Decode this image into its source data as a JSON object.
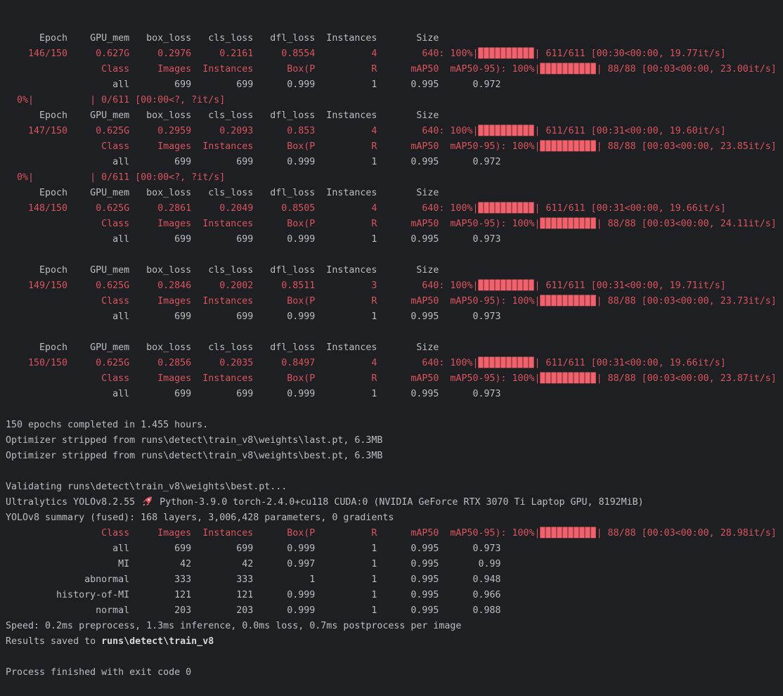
{
  "terminal": {
    "colors": {
      "background": "#1e1f22",
      "text_gray": "#bcbec4",
      "text_red": "#d9545e",
      "progress_bar_fill": "#f2606b",
      "bold_text": "#d6d9de"
    },
    "icons": {
      "rocket": "rocket-icon"
    },
    "lines": [
      {
        "name": "epoch-table-header",
        "segments": [
          {
            "style": "gray",
            "text": "      Epoch    GPU_mem   box_loss   cls_loss   dfl_loss  Instances       Size"
          }
        ]
      },
      {
        "name": "epoch-progress-row",
        "segments": [
          {
            "style": "red",
            "text": "    146/150     0.627G     0.2976     0.2161     0.8554          4        640: 100%|"
          },
          {
            "style": "bar",
            "text": "▉▉▉▉▉▉▉▉▉▉"
          },
          {
            "style": "red",
            "text": "| 611/611 [00:30<00:00, 19.77it/s]"
          }
        ]
      },
      {
        "name": "val-metrics-header",
        "segments": [
          {
            "style": "red",
            "text": "                 Class     Images  Instances      Box(P          R      mAP50  mAP50-95): 100%|"
          },
          {
            "style": "bar",
            "text": "▉▉▉▉▉▉▉▉▉▉"
          },
          {
            "style": "red",
            "text": "| 88/88 [00:03<00:00, 23.00it/s]"
          }
        ]
      },
      {
        "name": "val-all-row",
        "segments": [
          {
            "style": "gray",
            "text": "                   all        699        699      0.999          1      0.995      0.972"
          }
        ]
      },
      {
        "name": "dataloader-progress-row",
        "segments": [
          {
            "style": "red",
            "text": "  0%|          | 0/611 [00:00<?, ?it/s]"
          }
        ]
      },
      {
        "name": "epoch-table-header",
        "segments": [
          {
            "style": "gray",
            "text": "      Epoch    GPU_mem   box_loss   cls_loss   dfl_loss  Instances       Size"
          }
        ]
      },
      {
        "name": "epoch-progress-row",
        "segments": [
          {
            "style": "red",
            "text": "    147/150     0.625G     0.2959     0.2093      0.853          4        640: 100%|"
          },
          {
            "style": "bar",
            "text": "▉▉▉▉▉▉▉▉▉▉"
          },
          {
            "style": "red",
            "text": "| 611/611 [00:31<00:00, 19.60it/s]"
          }
        ]
      },
      {
        "name": "val-metrics-header",
        "segments": [
          {
            "style": "red",
            "text": "                 Class     Images  Instances      Box(P          R      mAP50  mAP50-95): 100%|"
          },
          {
            "style": "bar",
            "text": "▉▉▉▉▉▉▉▉▉▉"
          },
          {
            "style": "red",
            "text": "| 88/88 [00:03<00:00, 23.85it/s]"
          }
        ]
      },
      {
        "name": "val-all-row",
        "segments": [
          {
            "style": "gray",
            "text": "                   all        699        699      0.999          1      0.995      0.972"
          }
        ]
      },
      {
        "name": "dataloader-progress-row",
        "segments": [
          {
            "style": "red",
            "text": "  0%|          | 0/611 [00:00<?, ?it/s]"
          }
        ]
      },
      {
        "name": "epoch-table-header",
        "segments": [
          {
            "style": "gray",
            "text": "      Epoch    GPU_mem   box_loss   cls_loss   dfl_loss  Instances       Size"
          }
        ]
      },
      {
        "name": "epoch-progress-row",
        "segments": [
          {
            "style": "red",
            "text": "    148/150     0.625G     0.2861     0.2049     0.8505          4        640: 100%|"
          },
          {
            "style": "bar",
            "text": "▉▉▉▉▉▉▉▉▉▉"
          },
          {
            "style": "red",
            "text": "| 611/611 [00:31<00:00, 19.66it/s]"
          }
        ]
      },
      {
        "name": "val-metrics-header",
        "segments": [
          {
            "style": "red",
            "text": "                 Class     Images  Instances      Box(P          R      mAP50  mAP50-95): 100%|"
          },
          {
            "style": "bar",
            "text": "▉▉▉▉▉▉▉▉▉▉"
          },
          {
            "style": "red",
            "text": "| 88/88 [00:03<00:00, 24.11it/s]"
          }
        ]
      },
      {
        "name": "val-all-row",
        "segments": [
          {
            "style": "gray",
            "text": "                   all        699        699      0.999          1      0.995      0.973"
          }
        ]
      },
      {
        "name": "blank-line",
        "segments": []
      },
      {
        "name": "epoch-table-header",
        "segments": [
          {
            "style": "gray",
            "text": "      Epoch    GPU_mem   box_loss   cls_loss   dfl_loss  Instances       Size"
          }
        ]
      },
      {
        "name": "epoch-progress-row",
        "segments": [
          {
            "style": "red",
            "text": "    149/150     0.625G     0.2846     0.2002     0.8511          3        640: 100%|"
          },
          {
            "style": "bar",
            "text": "▉▉▉▉▉▉▉▉▉▉"
          },
          {
            "style": "red",
            "text": "| 611/611 [00:31<00:00, 19.71it/s]"
          }
        ]
      },
      {
        "name": "val-metrics-header",
        "segments": [
          {
            "style": "red",
            "text": "                 Class     Images  Instances      Box(P          R      mAP50  mAP50-95): 100%|"
          },
          {
            "style": "bar",
            "text": "▉▉▉▉▉▉▉▉▉▉"
          },
          {
            "style": "red",
            "text": "| 88/88 [00:03<00:00, 23.73it/s]"
          }
        ]
      },
      {
        "name": "val-all-row",
        "segments": [
          {
            "style": "gray",
            "text": "                   all        699        699      0.999          1      0.995      0.973"
          }
        ]
      },
      {
        "name": "blank-line",
        "segments": []
      },
      {
        "name": "epoch-table-header",
        "segments": [
          {
            "style": "gray",
            "text": "      Epoch    GPU_mem   box_loss   cls_loss   dfl_loss  Instances       Size"
          }
        ]
      },
      {
        "name": "epoch-progress-row",
        "segments": [
          {
            "style": "red",
            "text": "    150/150     0.625G     0.2856     0.2035     0.8497          4        640: 100%|"
          },
          {
            "style": "bar",
            "text": "▉▉▉▉▉▉▉▉▉▉"
          },
          {
            "style": "red",
            "text": "| 611/611 [00:31<00:00, 19.66it/s]"
          }
        ]
      },
      {
        "name": "val-metrics-header",
        "segments": [
          {
            "style": "red",
            "text": "                 Class     Images  Instances      Box(P          R      mAP50  mAP50-95): 100%|"
          },
          {
            "style": "bar",
            "text": "▉▉▉▉▉▉▉▉▉▉"
          },
          {
            "style": "red",
            "text": "| 88/88 [00:03<00:00, 23.87it/s]"
          }
        ]
      },
      {
        "name": "val-all-row",
        "segments": [
          {
            "style": "gray",
            "text": "                   all        699        699      0.999          1      0.995      0.973"
          }
        ]
      },
      {
        "name": "blank-line",
        "segments": []
      },
      {
        "name": "epochs-completed-line",
        "segments": [
          {
            "style": "gray",
            "text": "150 epochs completed in 1.455 hours."
          }
        ]
      },
      {
        "name": "optimizer-stripped-line",
        "segments": [
          {
            "style": "gray",
            "text": "Optimizer stripped from runs\\detect\\train_v8\\weights\\last.pt, 6.3MB"
          }
        ]
      },
      {
        "name": "optimizer-stripped-line",
        "segments": [
          {
            "style": "gray",
            "text": "Optimizer stripped from runs\\detect\\train_v8\\weights\\best.pt, 6.3MB"
          }
        ]
      },
      {
        "name": "blank-line",
        "segments": []
      },
      {
        "name": "validating-line",
        "segments": [
          {
            "style": "gray",
            "text": "Validating runs\\detect\\train_v8\\weights\\best.pt..."
          }
        ]
      },
      {
        "name": "ultralytics-version-line",
        "segments": [
          {
            "style": "gray",
            "text": "Ultralytics YOLOv8.2.55 "
          },
          {
            "style": "rocket",
            "text": "🚀"
          },
          {
            "style": "gray",
            "text": " Python-3.9.0 torch-2.4.0+cu118 CUDA:0 (NVIDIA GeForce RTX 3070 Ti Laptop GPU, 8192MiB)"
          }
        ]
      },
      {
        "name": "model-summary-line",
        "segments": [
          {
            "style": "gray",
            "text": "YOLOv8 summary (fused): 168 layers, 3,006,428 parameters, 0 gradients"
          }
        ]
      },
      {
        "name": "val-metrics-header",
        "segments": [
          {
            "style": "red",
            "text": "                 Class     Images  Instances      Box(P          R      mAP50  mAP50-95): 100%|"
          },
          {
            "style": "bar",
            "text": "▉▉▉▉▉▉▉▉▉▉"
          },
          {
            "style": "red",
            "text": "| 88/88 [00:03<00:00, 28.98it/s]"
          }
        ]
      },
      {
        "name": "val-class-row",
        "segments": [
          {
            "style": "gray",
            "text": "                   all        699        699      0.999          1      0.995      0.973"
          }
        ]
      },
      {
        "name": "val-class-row",
        "segments": [
          {
            "style": "gray",
            "text": "                    MI         42         42      0.997          1      0.995       0.99"
          }
        ]
      },
      {
        "name": "val-class-row",
        "segments": [
          {
            "style": "gray",
            "text": "              abnormal        333        333          1          1      0.995      0.948"
          }
        ]
      },
      {
        "name": "val-class-row",
        "segments": [
          {
            "style": "gray",
            "text": "         history-of-MI        121        121      0.999          1      0.995      0.966"
          }
        ]
      },
      {
        "name": "val-class-row",
        "segments": [
          {
            "style": "gray",
            "text": "                normal        203        203      0.999          1      0.995      0.988"
          }
        ]
      },
      {
        "name": "speed-line",
        "segments": [
          {
            "style": "gray",
            "text": "Speed: 0.2ms preprocess, 1.3ms inference, 0.0ms loss, 0.7ms postprocess per image"
          }
        ]
      },
      {
        "name": "results-saved-line",
        "segments": [
          {
            "style": "gray",
            "text": "Results saved to "
          },
          {
            "style": "bold",
            "text": "runs\\detect\\train_v8"
          }
        ]
      },
      {
        "name": "blank-line",
        "segments": []
      },
      {
        "name": "process-finished-line",
        "segments": [
          {
            "style": "gray",
            "text": "Process finished with exit code 0"
          }
        ]
      }
    ],
    "parsed": {
      "epoch_table_headers": [
        "Epoch",
        "GPU_mem",
        "box_loss",
        "cls_loss",
        "dfl_loss",
        "Instances",
        "Size"
      ],
      "epoch_rows": [
        {
          "epoch": "146/150",
          "gpu_mem": "0.627G",
          "box_loss": 0.2976,
          "cls_loss": 0.2161,
          "dfl_loss": 0.8554,
          "instances": 4,
          "size": 640,
          "train_progress": "100% 611/611 [00:30<00:00, 19.77it/s]",
          "val_progress": "100% 88/88 [00:03<00:00, 23.00it/s]",
          "all_row": [
            699,
            699,
            0.999,
            1,
            0.995,
            0.972
          ]
        },
        {
          "epoch": "147/150",
          "gpu_mem": "0.625G",
          "box_loss": 0.2959,
          "cls_loss": 0.2093,
          "dfl_loss": 0.853,
          "instances": 4,
          "size": 640,
          "train_progress": "100% 611/611 [00:31<00:00, 19.60it/s]",
          "val_progress": "100% 88/88 [00:03<00:00, 23.85it/s]",
          "all_row": [
            699,
            699,
            0.999,
            1,
            0.995,
            0.972
          ]
        },
        {
          "epoch": "148/150",
          "gpu_mem": "0.625G",
          "box_loss": 0.2861,
          "cls_loss": 0.2049,
          "dfl_loss": 0.8505,
          "instances": 4,
          "size": 640,
          "train_progress": "100% 611/611 [00:31<00:00, 19.66it/s]",
          "val_progress": "100% 88/88 [00:03<00:00, 24.11it/s]",
          "all_row": [
            699,
            699,
            0.999,
            1,
            0.995,
            0.973
          ]
        },
        {
          "epoch": "149/150",
          "gpu_mem": "0.625G",
          "box_loss": 0.2846,
          "cls_loss": 0.2002,
          "dfl_loss": 0.8511,
          "instances": 3,
          "size": 640,
          "train_progress": "100% 611/611 [00:31<00:00, 19.71it/s]",
          "val_progress": "100% 88/88 [00:03<00:00, 23.73it/s]",
          "all_row": [
            699,
            699,
            0.999,
            1,
            0.995,
            0.973
          ]
        },
        {
          "epoch": "150/150",
          "gpu_mem": "0.625G",
          "box_loss": 0.2856,
          "cls_loss": 0.2035,
          "dfl_loss": 0.8497,
          "instances": 4,
          "size": 640,
          "train_progress": "100% 611/611 [00:31<00:00, 19.66it/s]",
          "val_progress": "100% 88/88 [00:03<00:00, 23.87it/s]",
          "all_row": [
            699,
            699,
            0.999,
            1,
            0.995,
            0.973
          ]
        }
      ],
      "final_validation": {
        "headers": [
          "Class",
          "Images",
          "Instances",
          "Box(P",
          "R",
          "mAP50",
          "mAP50-95)"
        ],
        "rows": [
          [
            "all",
            699,
            699,
            0.999,
            1,
            0.995,
            0.973
          ],
          [
            "MI",
            42,
            42,
            0.997,
            1,
            0.995,
            0.99
          ],
          [
            "abnormal",
            333,
            333,
            1,
            1,
            0.995,
            0.948
          ],
          [
            "history-of-MI",
            121,
            121,
            0.999,
            1,
            0.995,
            0.966
          ],
          [
            "normal",
            203,
            203,
            0.999,
            1,
            0.995,
            0.988
          ]
        ]
      }
    }
  }
}
